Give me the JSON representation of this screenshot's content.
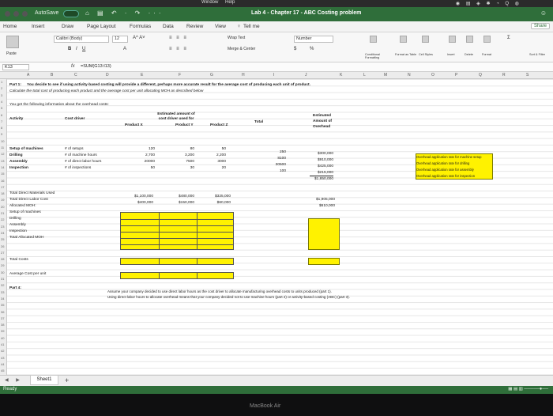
{
  "menubar": {
    "window": "Window",
    "help": "Help"
  },
  "titlebar": {
    "autosave": "AutoSave",
    "toggle": "OFF",
    "title": "Lab 4 - Chapter 17 - ABC Costing problem"
  },
  "tabs": [
    "Home",
    "Insert",
    "Draw",
    "Page Layout",
    "Formulas",
    "Data",
    "Review",
    "View"
  ],
  "tell_me": "Tell me",
  "share_label": "Share",
  "ribbon": {
    "font_name": "Calibri (Body)",
    "font_size": "12",
    "wrap_text": "Wrap Text",
    "merge_center": "Merge & Center",
    "number_format": "Number",
    "currency": "$",
    "percent": "%",
    "conditional": "Conditional Formatting",
    "format_table": "Format as Table",
    "cell_styles": "Cell Styles",
    "insert": "Insert",
    "delete": "Delete",
    "format": "Format",
    "sort_filter": "Sort & Filter",
    "paste": "Paste"
  },
  "formula_bar": {
    "cell_ref": "K13",
    "fx": "fx",
    "formula": "=SUM(G13:I13)"
  },
  "columns": [
    "A",
    "B",
    "C",
    "D",
    "E",
    "F",
    "G",
    "H",
    "I",
    "J",
    "K",
    "L",
    "M",
    "N",
    "O",
    "P",
    "Q",
    "R",
    "S"
  ],
  "rows": [
    "1",
    "2",
    "3",
    "4",
    "5",
    "6",
    "7",
    "8",
    "9",
    "10",
    "11",
    "12",
    "13",
    "14",
    "15",
    "16",
    "17",
    "18",
    "19",
    "20",
    "21",
    "22",
    "23",
    "24",
    "25",
    "26",
    "27",
    "28",
    "29",
    "30",
    "31",
    "32",
    "33",
    "34",
    "35",
    "36",
    "37",
    "38",
    "39",
    "40",
    "41",
    "42",
    "43",
    "44",
    "45",
    "46"
  ],
  "sheet": {
    "part1_title": "Part 1:",
    "part1_text": "You decide to see if using activity-based costing will provide a different, perhaps more accurate result for the average cost of producing each unit of product.",
    "part1_sub": "Calculate the total cost of producing each product and the average cost per unit allocating MOH as described below",
    "given": "You get the following information about the overhead costs:",
    "hdr_activity": "Activity",
    "hdr_cost_driver": "Cost driver",
    "hdr_estimated_amount": "Estimated amount of",
    "hdr_cost_driver_used": "cost driver used for",
    "hdr_product_x": "Product X",
    "hdr_product_y": "Product Y",
    "hdr_product_z": "Product Z",
    "hdr_total": "Total",
    "hdr_est_overhead_1": "Estimated",
    "hdr_est_overhead_2": "Amount of",
    "hdr_est_overhead_3": "Overhead",
    "activities": [
      {
        "name": "Setup of machines",
        "driver": "# of setups",
        "x": "120",
        "y": "80",
        "z": "50",
        "total": "250",
        "overhead": "$300,000",
        "rate_label": "Overhead application rate for machine setup"
      },
      {
        "name": "Drilling",
        "driver": "# of machine hours",
        "x": "2,700",
        "y": "3,200",
        "z": "2,200",
        "total": "8100",
        "overhead": "$910,000",
        "rate_label": "Overhead application rate for drilling"
      },
      {
        "name": "Assembly",
        "driver": "# of direct labor hours",
        "x": "20000",
        "y": "7500",
        "z": "3000",
        "total": "30500",
        "overhead": "$425,000",
        "rate_label": "Overhead application rate for assembly"
      },
      {
        "name": "Inspection",
        "driver": "# of inspections",
        "x": "50",
        "y": "30",
        "z": "20",
        "total": "100",
        "overhead": "$215,000",
        "rate_label": "Overhead application rate for inspection"
      }
    ],
    "overhead_total": "$1,850,000",
    "dm_label": "Total Direct Materials Used",
    "dl_label": "Total Direct Labor Cost",
    "dm": {
      "x": "$1,100,000",
      "y": "$480,000",
      "z": "$325,000",
      "total": "$1,905,000"
    },
    "dl": {
      "x": "$400,000",
      "y": "$150,000",
      "z": "$60,000",
      "total": "$610,000"
    },
    "allocated_moh": "Allocated MOH:",
    "alloc_rows": [
      "Setup of machines",
      "Drilling",
      "Assembly",
      "Inspection",
      "Total Allocated MOH"
    ],
    "total_costs": "Total Costs",
    "avg_cost": "Average Cost per unit",
    "part4_title": "Part 4:",
    "part4_line1": "Assume your company decided to use direct labor hours as the cost driver to allocate manufacturing overhead costs to units produced (part 1).",
    "part4_line2": "Using direct labor hours to allocate overhead means that your company decided not to use machine hours (part 2) or activity-based costing (ABC) (part 3)."
  },
  "sheet_tab": "Sheet1",
  "status": {
    "ready": "Ready"
  },
  "bezel_text": "MacBook Air"
}
